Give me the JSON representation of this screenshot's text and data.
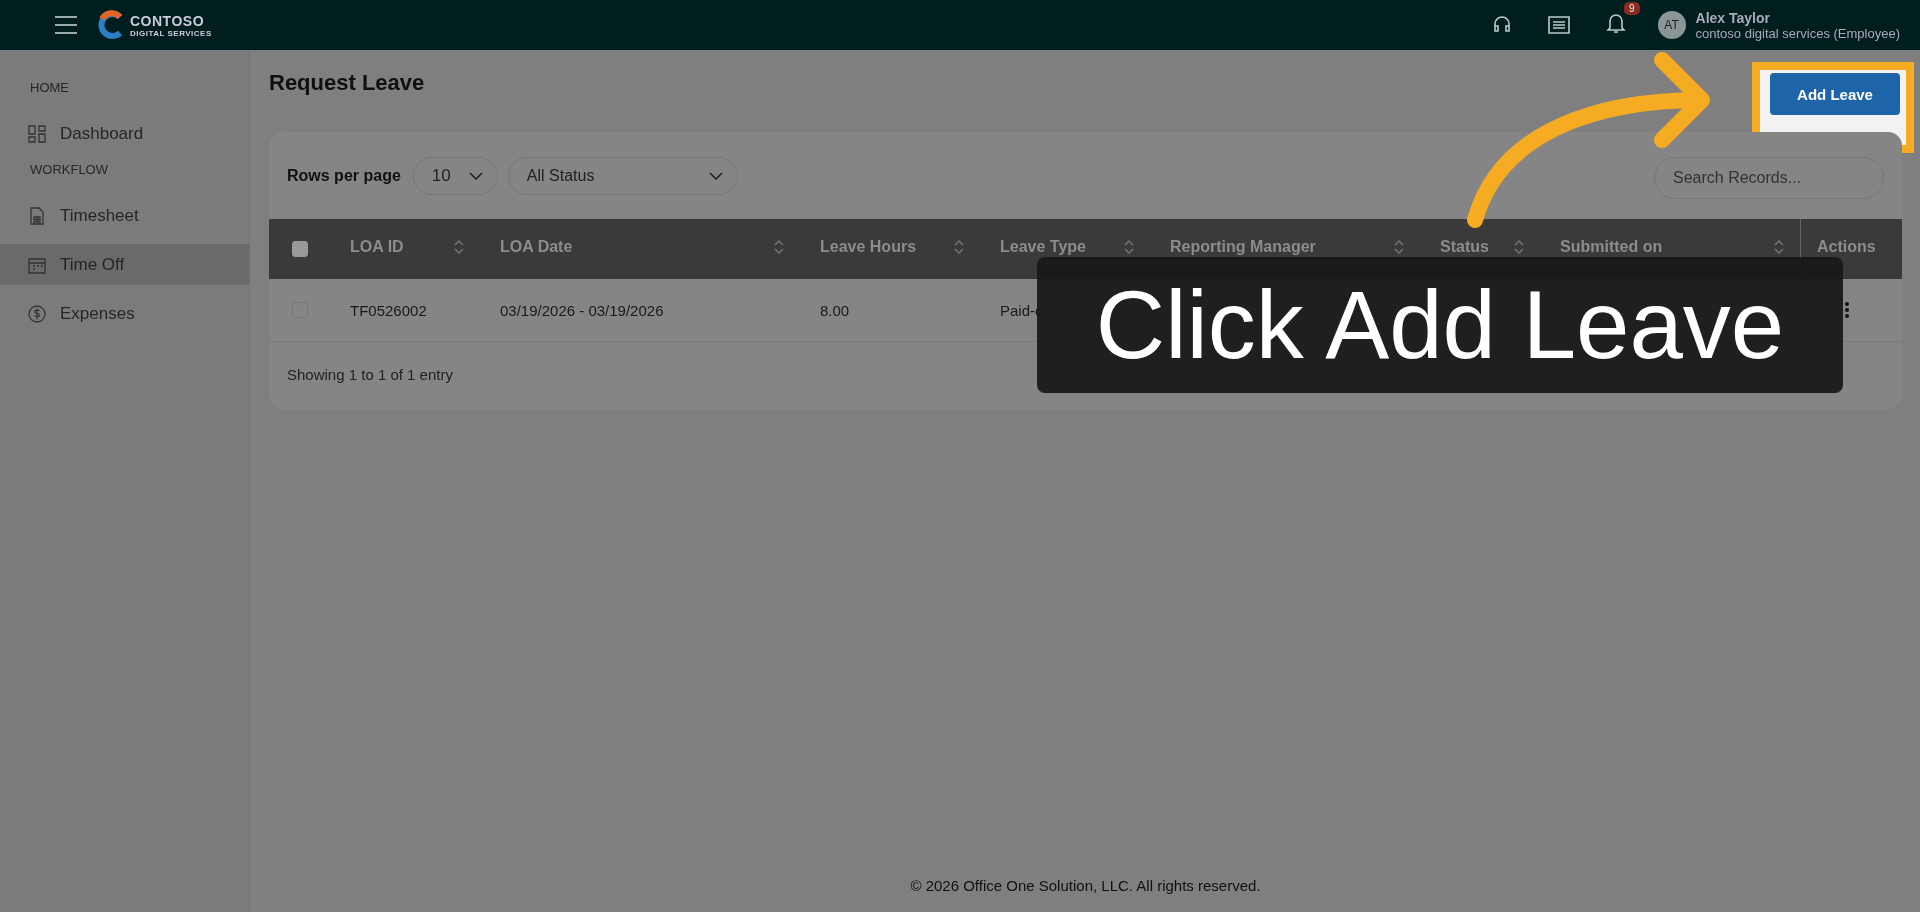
{
  "topbar": {
    "brand": "CONTOSO",
    "brand_sub": "DIGITAL SERVICES",
    "notifications": "9",
    "user": {
      "initials": "AT",
      "name": "Alex Taylor",
      "org": "contoso digital services (Employee)"
    }
  },
  "sidebar": {
    "sections": [
      {
        "title": "HOME",
        "items": [
          {
            "label": "Dashboard",
            "selected": false
          }
        ]
      },
      {
        "title": "WORKFLOW",
        "items": [
          {
            "label": "Timesheet",
            "selected": false
          },
          {
            "label": "Time Off",
            "selected": true
          },
          {
            "label": "Expenses",
            "selected": false
          }
        ]
      }
    ]
  },
  "page": {
    "title": "Request Leave",
    "add_button": "Add Leave"
  },
  "filters": {
    "rows_label": "Rows per page",
    "rows_value": "10",
    "status_value": "All Status",
    "search_placeholder": "Search Records..."
  },
  "table": {
    "all_checked": false,
    "columns": [
      {
        "label": "LOA ID",
        "sortable": true
      },
      {
        "label": "LOA Date",
        "sortable": true
      },
      {
        "label": "Leave Hours",
        "sortable": true
      },
      {
        "label": "Leave Type",
        "sortable": true
      },
      {
        "label": "Reporting Manager",
        "sortable": true
      },
      {
        "label": "Status",
        "sortable": true
      },
      {
        "label": "Submitted on",
        "sortable": true
      },
      {
        "label": "Actions",
        "sortable": false
      }
    ],
    "rows": [
      {
        "checked": false,
        "cells": [
          "TF0526002",
          "03/19/2026 - 03/19/2026",
          "8.00",
          "Paid-o"
        ]
      }
    ],
    "summary": "Showing 1 to 1 of 1 entry"
  },
  "footer": "© 2026 Office One Solution, LLC. All rights reserved.",
  "callout": {
    "text": "Click Add Leave"
  }
}
